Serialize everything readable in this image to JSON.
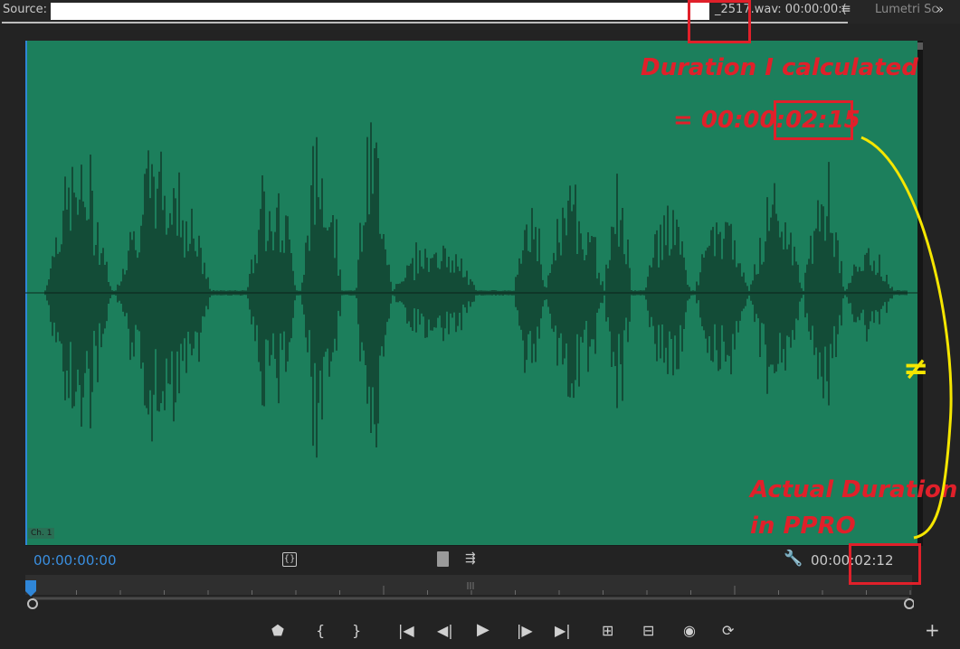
{
  "source_panel": {
    "source_prefix": "Source: S",
    "file_text": "_2517.wav: 00:00:00:(",
    "menu_icon": "hamburger-menu-icon",
    "lumetri_tab": "Lumetri Sc",
    "more_icon": "double-chevron-right-icon"
  },
  "waveform": {
    "channel_label": "Ch. 1",
    "color": "#1c7f5c"
  },
  "timecodes": {
    "current": "00:00:00:00",
    "duration": "00:00:02:12"
  },
  "annotations": {
    "calc_line1": "Duration I calculated",
    "calc_line2": "= 00:00:02:15",
    "not_equal": "≠",
    "actual_line1": "Actual Duration",
    "actual_line2": "in PPRO",
    "annotation_color": "#e0202a",
    "arrow_color": "#f5e600"
  },
  "controls": {
    "insert_clip_icon": "insert-clip-icon",
    "drag_video_icon": "drag-video-icon",
    "drag_audio_icon": "drag-audio-icon",
    "settings_icon": "wrench-icon",
    "transport": [
      "add-marker-icon",
      "mark-in-icon",
      "mark-out-icon",
      "go-to-in-icon",
      "step-back-icon",
      "play-icon",
      "step-forward-icon",
      "go-to-out-icon",
      "insert-icon",
      "overwrite-icon",
      "export-frame-icon",
      "replace-icon",
      "add-button-icon"
    ]
  }
}
